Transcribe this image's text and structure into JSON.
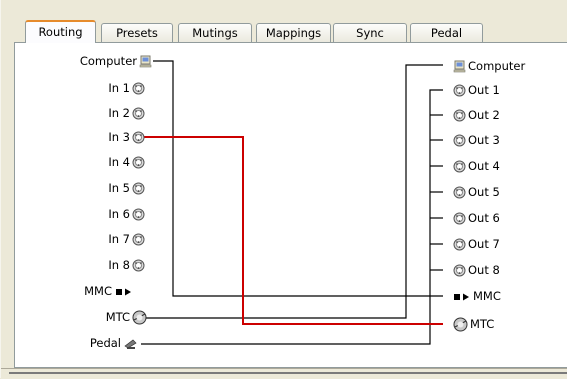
{
  "tabs": [
    {
      "label": "Routing",
      "active": true
    },
    {
      "label": "Presets",
      "active": false
    },
    {
      "label": "Mutings",
      "active": false
    },
    {
      "label": "Mappings",
      "active": false
    },
    {
      "label": "Sync",
      "active": false
    },
    {
      "label": "Pedal",
      "active": false
    }
  ],
  "inputs": [
    {
      "label": "Computer",
      "icon": "computer-icon"
    },
    {
      "label": "In 1",
      "icon": "midi-port-icon"
    },
    {
      "label": "In 2",
      "icon": "midi-port-icon"
    },
    {
      "label": "In 3",
      "icon": "midi-port-icon"
    },
    {
      "label": "In 4",
      "icon": "midi-port-icon"
    },
    {
      "label": "In 5",
      "icon": "midi-port-icon"
    },
    {
      "label": "In 6",
      "icon": "midi-port-icon"
    },
    {
      "label": "In 7",
      "icon": "midi-port-icon"
    },
    {
      "label": "In 8",
      "icon": "midi-port-icon"
    },
    {
      "label": "MMC",
      "icon": "mmc-transport-icon"
    },
    {
      "label": "MTC",
      "icon": "mtc-clock-icon"
    },
    {
      "label": "Pedal",
      "icon": "pedal-icon"
    }
  ],
  "outputs": [
    {
      "label": "Computer",
      "icon": "computer-icon"
    },
    {
      "label": "Out 1",
      "icon": "midi-port-icon"
    },
    {
      "label": "Out 2",
      "icon": "midi-port-icon"
    },
    {
      "label": "Out 3",
      "icon": "midi-port-icon"
    },
    {
      "label": "Out 4",
      "icon": "midi-port-icon"
    },
    {
      "label": "Out 5",
      "icon": "midi-port-icon"
    },
    {
      "label": "Out 6",
      "icon": "midi-port-icon"
    },
    {
      "label": "Out 7",
      "icon": "midi-port-icon"
    },
    {
      "label": "Out 8",
      "icon": "midi-port-icon"
    },
    {
      "label": "MMC",
      "icon": "mmc-transport-icon"
    },
    {
      "label": "MTC",
      "icon": "mtc-clock-icon"
    }
  ],
  "routes": [
    {
      "from": "Computer",
      "to": "MMC",
      "color": "#000000",
      "highlighted": false
    },
    {
      "from": "In 3",
      "to": "MTC",
      "color": "#cc0000",
      "highlighted": true
    },
    {
      "from": "MTC",
      "to": "Computer",
      "color": "#000000",
      "highlighted": false
    },
    {
      "from": "Pedal",
      "to": "Out 1",
      "color": "#000000",
      "highlighted": false
    }
  ],
  "colors": {
    "accent_tab": "#e68b2c",
    "highlight_route": "#cc0000",
    "window_bg": "#ece9d8"
  }
}
